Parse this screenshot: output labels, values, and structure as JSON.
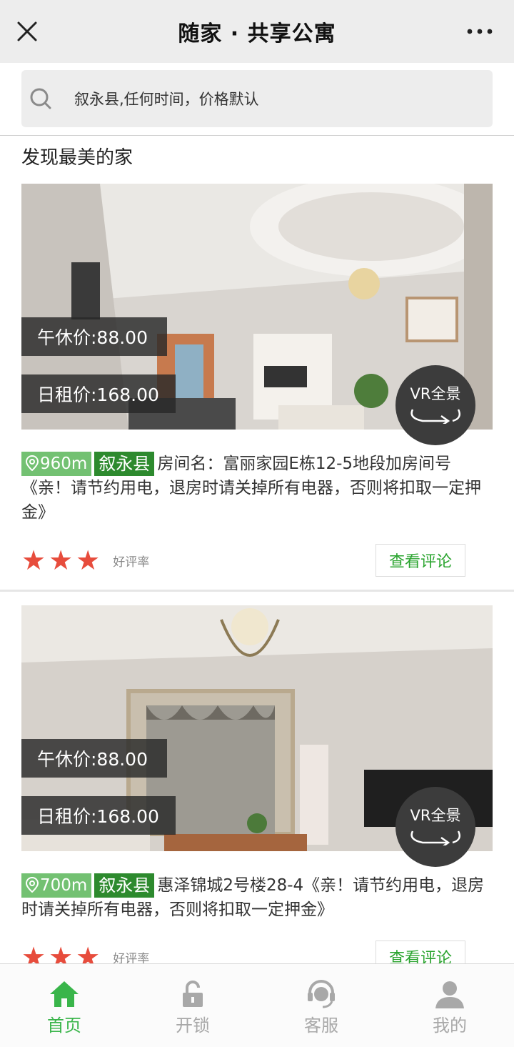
{
  "header": {
    "title": "随家 · 共享公寓"
  },
  "search": {
    "text": "叙永县,任何时间，价格默认"
  },
  "section_title": "发现最美的家",
  "listings": [
    {
      "noon_price": "午休价:88.00",
      "day_price": "日租价:168.00",
      "vr_label": "VR全景",
      "distance": "960m",
      "location": "叙永县",
      "description": "房间名：富丽家园E栋12-5地段加房间号《亲！请节约用电，退房时请关掉所有电器，否则将扣取一定押金》",
      "stars": 3,
      "rating_label": "好评率",
      "review_button": "查看评论"
    },
    {
      "noon_price": "午休价:88.00",
      "day_price": "日租价:168.00",
      "vr_label": "VR全景",
      "distance": "700m",
      "location": "叙永县",
      "description": "惠泽锦城2号楼28-4《亲！请节约用电，退房时请关掉所有电器，否则将扣取一定押金》",
      "stars": 3,
      "rating_label": "好评率",
      "review_button": "查看评论"
    }
  ],
  "nav": [
    {
      "label": "首页",
      "icon": "home-icon",
      "active": true
    },
    {
      "label": "开锁",
      "icon": "unlock-icon",
      "active": false
    },
    {
      "label": "客服",
      "icon": "headset-icon",
      "active": false
    },
    {
      "label": "我的",
      "icon": "user-icon",
      "active": false
    }
  ],
  "colors": {
    "active": "#39b54a",
    "star": "#e74c3c",
    "chip_distance": "#73c172",
    "chip_location": "#2d8a2e"
  }
}
